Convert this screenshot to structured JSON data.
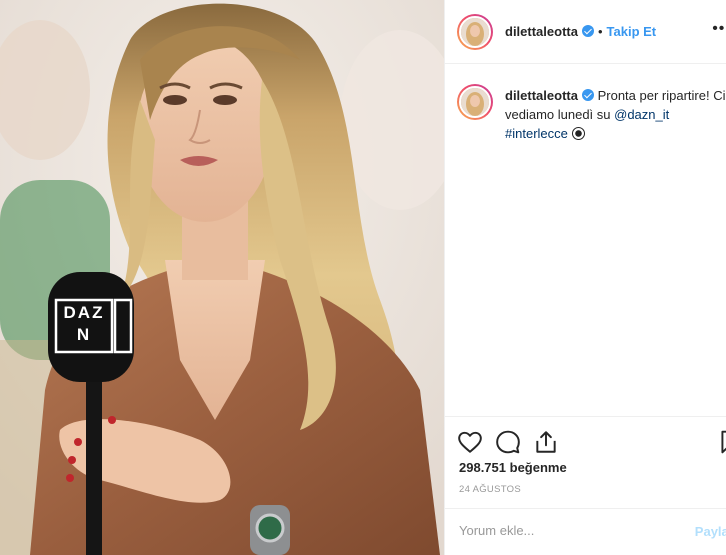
{
  "account": {
    "username": "dilettaleotta",
    "verified": true,
    "follow_label": "Takip Et",
    "separator": "•"
  },
  "photo": {
    "mic_brand": "DAZN"
  },
  "caption": {
    "username": "dilettaleotta",
    "text_part1": "Pronta per ripartire! Ci vediamo lunedì su ",
    "mention": "@dazn_it",
    "hashtag": "#interlecce",
    "emoji_icon": "soccer-ball-icon"
  },
  "actions": {
    "like_icon": "heart-icon",
    "comment_icon": "comment-icon",
    "share_icon": "share-icon",
    "save_icon": "bookmark-icon"
  },
  "likes": {
    "count": "298.751",
    "label": "beğenme"
  },
  "date_label": "24 AĞUSTOS",
  "comment": {
    "placeholder": "Yorum ekle...",
    "post_label": "Paylaş"
  },
  "colors": {
    "accent_blue": "#3897f0",
    "link_blue": "#003569",
    "post_disabled": "#b2dffc",
    "border": "#efefef"
  }
}
